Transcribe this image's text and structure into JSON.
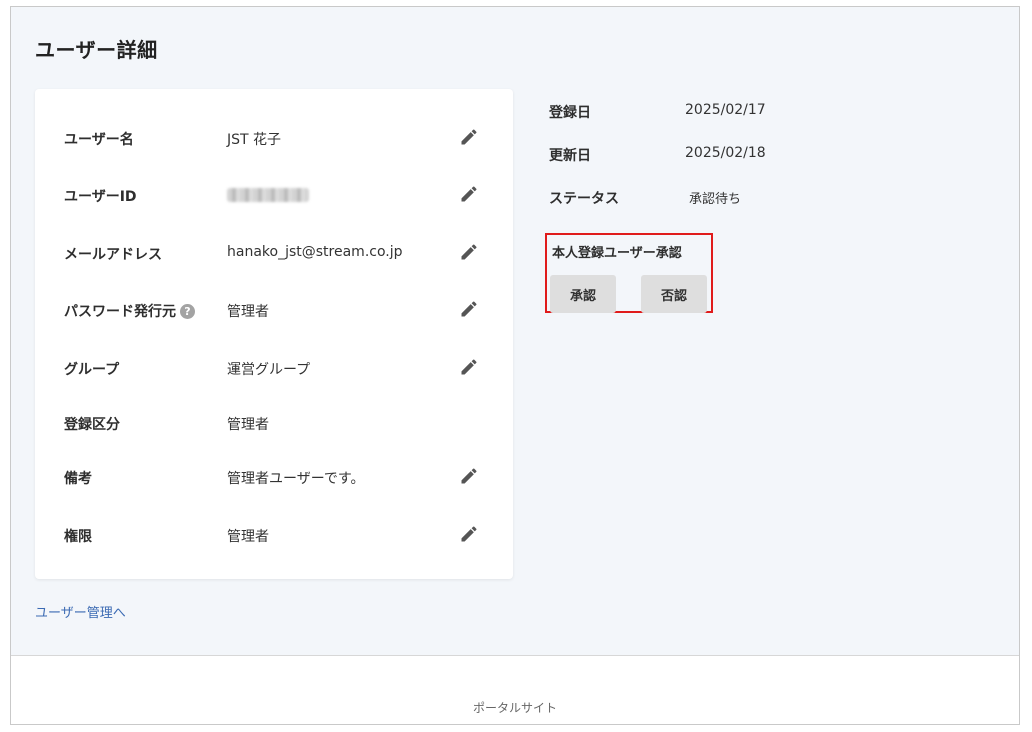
{
  "header": {
    "title": "ユーザー詳細"
  },
  "details": [
    {
      "label": "ユーザー名",
      "value": "JST 花子",
      "editable": true,
      "help": false,
      "masked": false
    },
    {
      "label": "ユーザーID",
      "value": "",
      "editable": true,
      "help": false,
      "masked": true
    },
    {
      "label": "メールアドレス",
      "value": "hanako_jst@stream.co.jp",
      "editable": true,
      "help": false,
      "masked": false
    },
    {
      "label": "パスワード発行元",
      "value": "管理者",
      "editable": true,
      "help": true,
      "masked": false
    },
    {
      "label": "グループ",
      "value": "運営グループ",
      "editable": true,
      "help": false,
      "masked": false
    },
    {
      "label": "登録区分",
      "value": "管理者",
      "editable": false,
      "help": false,
      "masked": false
    },
    {
      "label": "備考",
      "value": "管理者ユーザーです。",
      "editable": true,
      "help": false,
      "masked": false
    },
    {
      "label": "権限",
      "value": "管理者",
      "editable": true,
      "help": false,
      "masked": false
    }
  ],
  "meta": {
    "registered_label": "登録日",
    "registered_value": "2025/02/17",
    "updated_label": "更新日",
    "updated_value": "2025/02/18",
    "status_label": "ステータス",
    "status_value": "承認待ち"
  },
  "approval": {
    "title": "本人登録ユーザー承認",
    "approve_label": "承認",
    "reject_label": "否認",
    "highlight_color": "#e01b1b"
  },
  "help_icon": {
    "glyph": "?"
  },
  "links": {
    "back": "ユーザー管理へ"
  },
  "footer": {
    "text": "ポータルサイト"
  },
  "icons": {
    "edit": "pencil-icon",
    "help": "question-circle-icon"
  },
  "colors": {
    "background": "#f3f6fa",
    "link": "#3b6ab3",
    "button": "#dedede"
  }
}
